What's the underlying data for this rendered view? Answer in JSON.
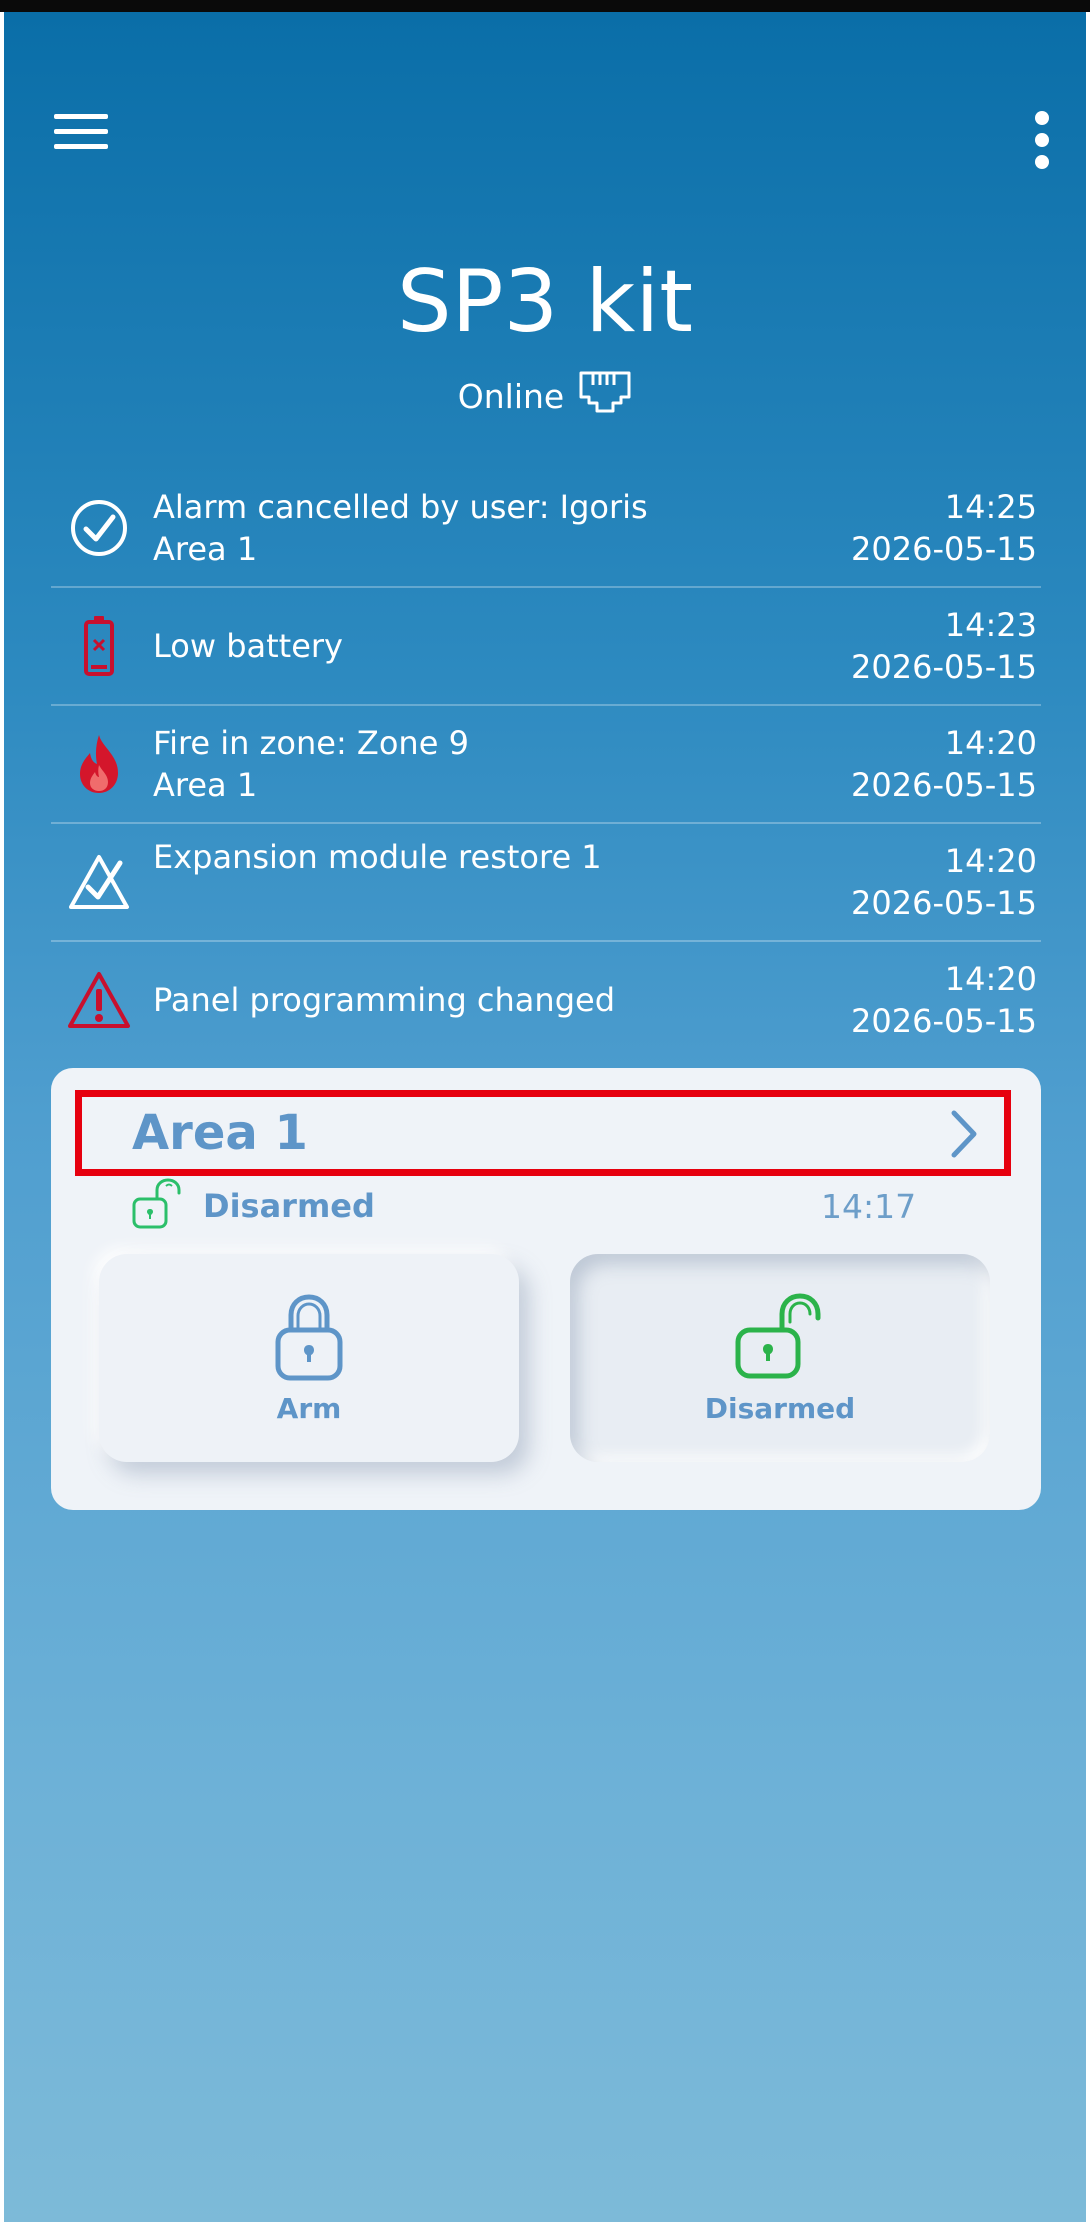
{
  "app": {
    "title": "SP3 kit",
    "status": "Online"
  },
  "header": {
    "menu_icon": "hamburger-menu-icon",
    "more_icon": "more-vertical-icon"
  },
  "events": [
    {
      "icon": "check-circle-icon",
      "line1": "Alarm cancelled by user: Igoris",
      "line2": "Area 1",
      "time": "14:25",
      "date": "2026-05-15"
    },
    {
      "icon": "low-battery-icon",
      "line1": "Low battery",
      "line2": "",
      "time": "14:23",
      "date": "2026-05-15"
    },
    {
      "icon": "fire-icon",
      "line1": "Fire in zone: Zone 9",
      "line2": "Area 1",
      "time": "14:20",
      "date": "2026-05-15"
    },
    {
      "icon": "module-restore-icon",
      "line1": "Expansion module restore 1",
      "line2": "",
      "time": "14:20",
      "date": "2026-05-15"
    },
    {
      "icon": "warning-icon",
      "line1": "Panel programming changed",
      "line2": "",
      "time": "14:20",
      "date": "2026-05-15"
    }
  ],
  "area": {
    "name": "Area 1",
    "state": "Disarmed",
    "time": "14:17",
    "arm_label": "Arm",
    "disarm_label": "Disarmed"
  },
  "colors": {
    "accent_blue": "#5e95c8",
    "disarmed_green": "#2bb34a",
    "alert_red": "#c8102e",
    "highlight_red": "#e6000f"
  }
}
